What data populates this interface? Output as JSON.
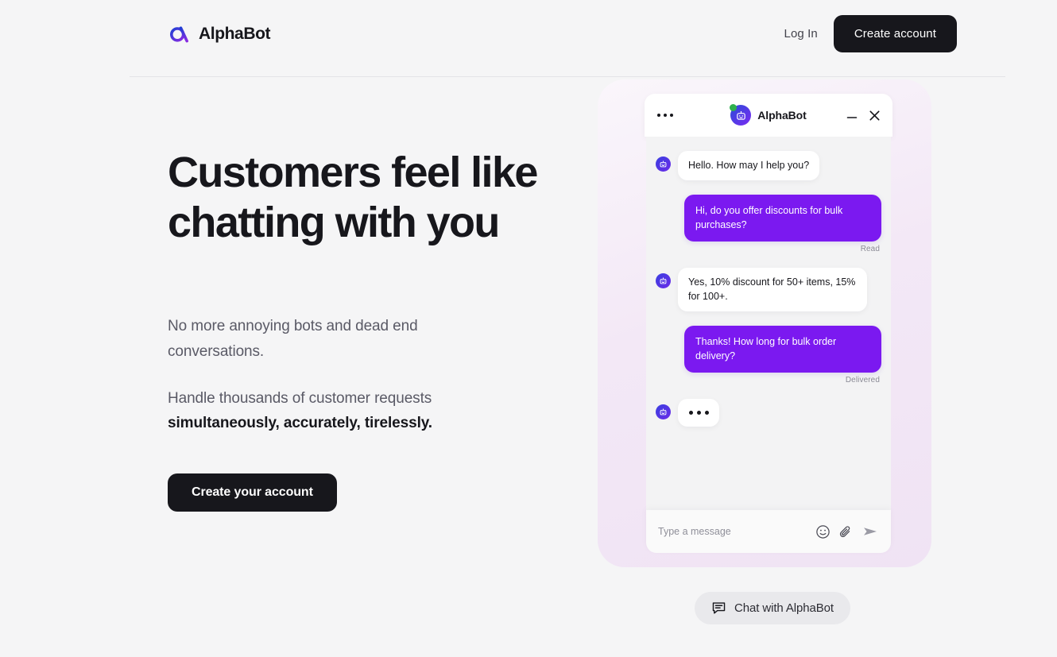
{
  "brand": {
    "name": "AlphaBot",
    "logo_icon": "alpha-logo-icon",
    "gradient_start": "#1f3fd4",
    "gradient_end": "#8a2be2"
  },
  "header": {
    "login_label": "Log In",
    "create_account_label": "Create account"
  },
  "hero": {
    "title": "Customers feel like chatting with you",
    "paragraph_1": "No more annoying bots and dead end conversations.",
    "paragraph_2_lead": "Handle thousands of customer requests",
    "paragraph_2_strong": "simultaneously, accurately, tirelessly.",
    "cta_label": "Create your account"
  },
  "chat_widget": {
    "title": "AlphaBot",
    "menu_icon": "ellipsis-icon",
    "avatar_icon": "robot-avatar-icon",
    "status": "online",
    "status_color": "#2fb14e",
    "minimize_icon": "minimize-icon",
    "close_icon": "close-icon",
    "messages": [
      {
        "sender": "bot",
        "text": "Hello. How may I help you?",
        "status": ""
      },
      {
        "sender": "user",
        "text": "Hi, do you offer discounts for bulk purchases?",
        "status": "Read"
      },
      {
        "sender": "bot",
        "text": "Yes, 10% discount for 50+ items, 15% for 100+.",
        "status": ""
      },
      {
        "sender": "user",
        "text": "Thanks! How long for bulk order delivery?",
        "status": "Delivered"
      },
      {
        "sender": "bot",
        "text": "",
        "status": "",
        "typing": true
      }
    ],
    "input": {
      "value": "",
      "placeholder": "Type a message",
      "emoji_icon": "emoji-smiley-icon",
      "attach_icon": "paperclip-icon",
      "send_icon": "send-arrow-icon"
    },
    "bubble_user_color": "#7b19f0",
    "bubble_bot_color": "#ffffff"
  },
  "chat_pill": {
    "label": "Chat with AlphaBot",
    "icon": "chat-bubble-icon"
  }
}
